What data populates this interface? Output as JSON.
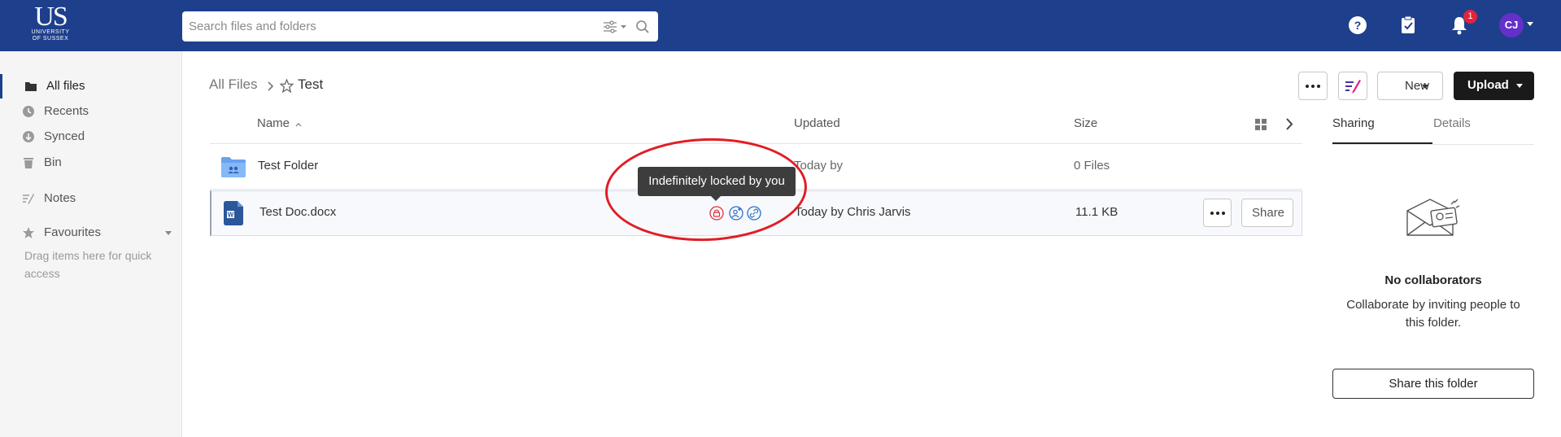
{
  "header": {
    "logo_text": "US",
    "logo_subtext_1": "UNIVERSITY",
    "logo_subtext_2": "OF SUSSEX",
    "search_placeholder": "Search files and folders",
    "notification_count": "1",
    "avatar_initials": "CJ",
    "colors": {
      "bar": "#1e3f8c",
      "badge": "#e2243b",
      "avatar": "#6330c9"
    },
    "icons": [
      "search-icon",
      "filter-icon",
      "help-icon",
      "tasks-icon",
      "bell-icon"
    ]
  },
  "sidebar": {
    "items": [
      {
        "label": "All files",
        "icon": "folder-icon",
        "active": true
      },
      {
        "label": "Recents",
        "icon": "clock-icon"
      },
      {
        "label": "Synced",
        "icon": "sync-icon"
      },
      {
        "label": "Bin",
        "icon": "trash-icon"
      },
      {
        "label": "Notes",
        "icon": "notes-icon"
      },
      {
        "label": "Favourites",
        "icon": "star-icon"
      }
    ],
    "drag_hint": "Drag items here for quick access"
  },
  "breadcrumb": {
    "root": "All Files",
    "current": "Test"
  },
  "toolbar": {
    "new_label": "New",
    "upload_label": "Upload"
  },
  "table": {
    "columns": {
      "name": "Name",
      "updated": "Updated",
      "size": "Size"
    },
    "rows": [
      {
        "name": "Test Folder",
        "updated": "Today by",
        "size": "0 Files",
        "icon": "shared-folder-icon"
      },
      {
        "name": "Test Doc.docx",
        "updated": "Today by Chris Jarvis",
        "size": "11.1 KB",
        "icon": "word-doc-icon",
        "share_label": "Share"
      }
    ]
  },
  "tooltip": {
    "text": "Indefinitely locked by you"
  },
  "panel": {
    "tabs": [
      "Sharing",
      "Details"
    ],
    "active_tab": "Sharing",
    "empty_title": "No collaborators",
    "empty_desc": "Collaborate by inviting people to this folder.",
    "share_folder_label": "Share this folder"
  }
}
